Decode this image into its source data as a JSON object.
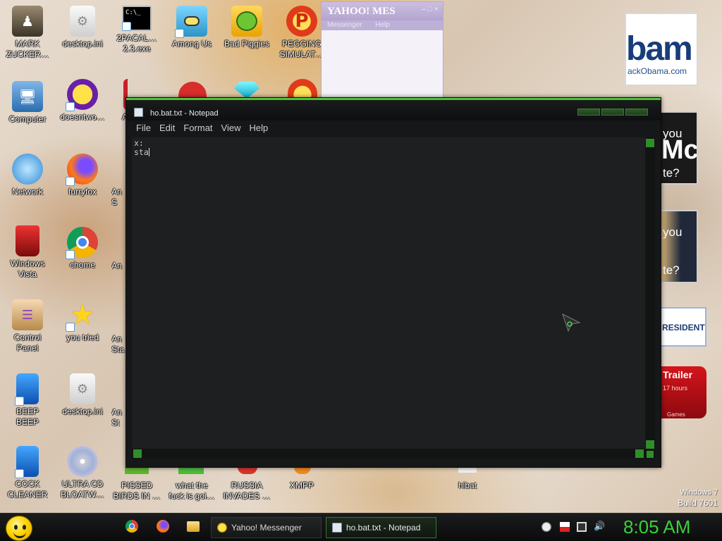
{
  "desktop": {
    "icons": [
      {
        "label": "MARK\nZUCKER…",
        "icon": "mark-zuckerberg-icon"
      },
      {
        "label": "desktop.ini",
        "icon": "settings-file-icon"
      },
      {
        "label": "2PACAL…\n2.3.exe",
        "icon": "cmd-exe-icon"
      },
      {
        "label": "Among Us",
        "icon": "among-us-icon"
      },
      {
        "label": "Bad Piggies",
        "icon": "bad-piggies-icon"
      },
      {
        "label": "PEGGING\nSIMULAT…",
        "icon": "p-app-icon"
      },
      {
        "label": "Computer",
        "icon": "computer-icon"
      },
      {
        "label": "doesntwo…",
        "icon": "yahoo-icon"
      },
      {
        "label": "Network",
        "icon": "network-icon"
      },
      {
        "label": "furryfox",
        "icon": "firefox-icon"
      },
      {
        "label": "Windows\nVista",
        "icon": "vista-bin-icon"
      },
      {
        "label": "chome",
        "icon": "chrome-icon"
      },
      {
        "label": "Control\nPanel",
        "icon": "control-panel-icon"
      },
      {
        "label": "you tried",
        "icon": "star-icon"
      },
      {
        "label": "BEEP\nBEEP",
        "icon": "blue-tile-icon"
      },
      {
        "label": "desktop.ini",
        "icon": "settings-file-icon"
      },
      {
        "label": "COCK\nCLEANER",
        "icon": "blue-tile-icon"
      },
      {
        "label": "ULTRA CD\nBLOATW…",
        "icon": "cd-icon"
      },
      {
        "label": "PISSED\nBIRDS IN …",
        "icon": "angry-birds-icon"
      },
      {
        "label": "what the\nfuck is goi…",
        "icon": "shortcut-icon"
      },
      {
        "label": "RUSSIA\nINVADES …",
        "icon": "shortcut-icon"
      },
      {
        "label": "XMPP",
        "icon": "xmpp-icon"
      },
      {
        "label": "hibat",
        "icon": "batch-file-icon"
      }
    ],
    "partial_labels": {
      "row2": "A",
      "row3": "An\nS",
      "row4": "An",
      "row5": "An\nSta",
      "row6": "An\nSt"
    },
    "ads": {
      "obama_text": "bam",
      "obama_url": "ackObama.com",
      "mc_top": "you",
      "mc_big": "Mc",
      "mc_bottom": "te?",
      "hillary_top": "you",
      "hillary_bottom": "te?",
      "president": "RESIDENT",
      "trailer": "Trailer",
      "trailer_sub": "17 hours",
      "trailer_footer": "Games"
    },
    "watermark": {
      "line1": "Windows 7",
      "line2": "Build 7601"
    }
  },
  "yahoo_window": {
    "title": "YAHOO! MES",
    "menu": [
      "Messenger",
      "Help"
    ],
    "controls": "– □ ×"
  },
  "notepad": {
    "title": "ho.bat.txt - Notepad",
    "menu": [
      "File",
      "Edit",
      "Format",
      "View",
      "Help"
    ],
    "content_line1": "x:",
    "content_line2": "sta"
  },
  "taskbar": {
    "buttons": [
      {
        "label": "Yahoo! Messenger"
      },
      {
        "label": "ho.bat.txt - Notepad"
      }
    ],
    "clock": "8:05 AM",
    "accent": "#39d13a"
  }
}
